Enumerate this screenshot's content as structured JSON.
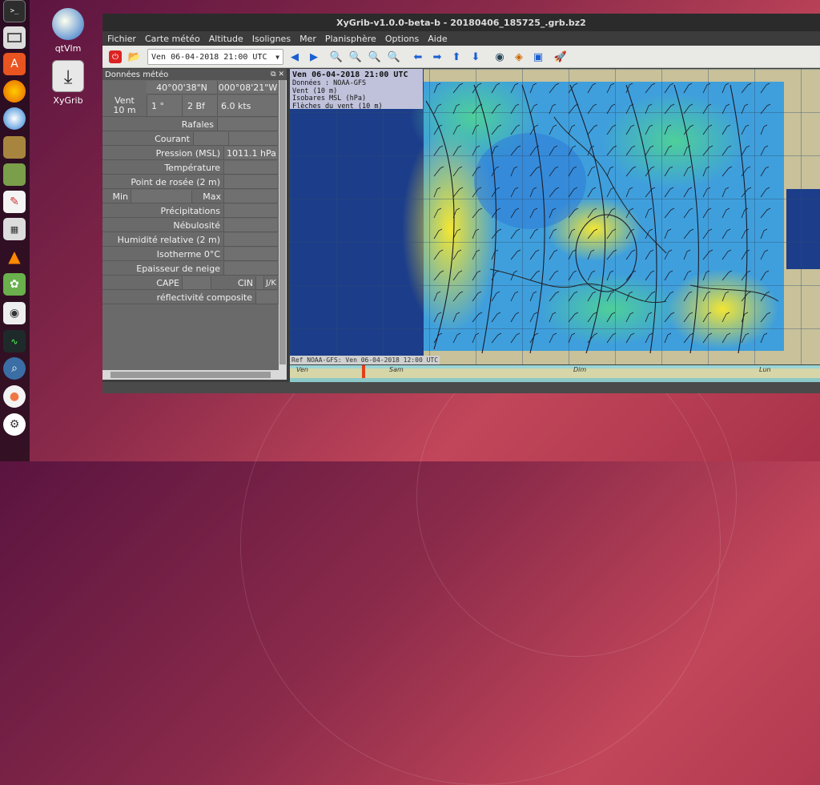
{
  "desktop": {
    "icons": [
      {
        "label": "qtVlm"
      },
      {
        "label": "XyGrib"
      }
    ]
  },
  "dock": {
    "items": [
      "terminal-icon",
      "file-manager-icon",
      "software-center-icon",
      "firefox-icon",
      "thunderbird-icon",
      "archive-icon",
      "files-icon",
      "drawing-icon",
      "calculator-icon",
      "vlc-icon",
      "gimp-icon",
      "camera-icon",
      "system-monitor-icon",
      "search-icon",
      "bulb-icon",
      "app-icon"
    ]
  },
  "window": {
    "title": "XyGrib-v1.0.0-beta-b - 20180406_185725_.grb.bz2",
    "menu": [
      "Fichier",
      "Carte météo",
      "Altitude",
      "Isolignes",
      "Mer",
      "Planisphère",
      "Options",
      "Aide"
    ],
    "date_select": "Ven 06-04-2018 21:00 UTC"
  },
  "panel": {
    "title": "Données météo",
    "lat": "40°00'38\"N",
    "lon": "000°08'21\"W",
    "vent_label": "Vent",
    "vent_height": "10 m",
    "vent_dir": "1 °",
    "vent_bf": "2 Bf",
    "vent_kts": "6.0  kts",
    "rafales": "Rafales",
    "courant": "Courant",
    "pression_label": "Pression (MSL)",
    "pression_value": "1011.1 hPa",
    "temperature": "Température",
    "rosee": "Point de rosée (2 m)",
    "min": "Min",
    "max": "Max",
    "precipitations": "Précipitations",
    "nebulosite": "Nébulosité",
    "humidite": "Humidité relative (2 m)",
    "isotherme": "Isotherme 0°C",
    "neige": "Epaisseur de neige",
    "cape": "CAPE",
    "cin": "CIN",
    "jk": "J/K",
    "reflectivite": "réflectivité composite"
  },
  "map": {
    "header": "Ven 06-04-2018 21:00 UTC",
    "line1": "Données : NOAA-GFS",
    "line2": "Vent (10 m)",
    "line3": "Isobares MSL (hPa)",
    "line4": "Flèches du vent (10 m)",
    "ref": "Ref NOAA-GFS: Ven 06-04-2018 12:00 UTC"
  },
  "timeline": {
    "days": [
      "Ven",
      "Sam",
      "Dim",
      "Lun"
    ]
  },
  "colors": {
    "ocean": "#1c3d8a",
    "land": "#c8c19a",
    "wind_low": "#2e7fd9",
    "wind_mid": "#33c7a0",
    "wind_high": "#f0e23a"
  }
}
